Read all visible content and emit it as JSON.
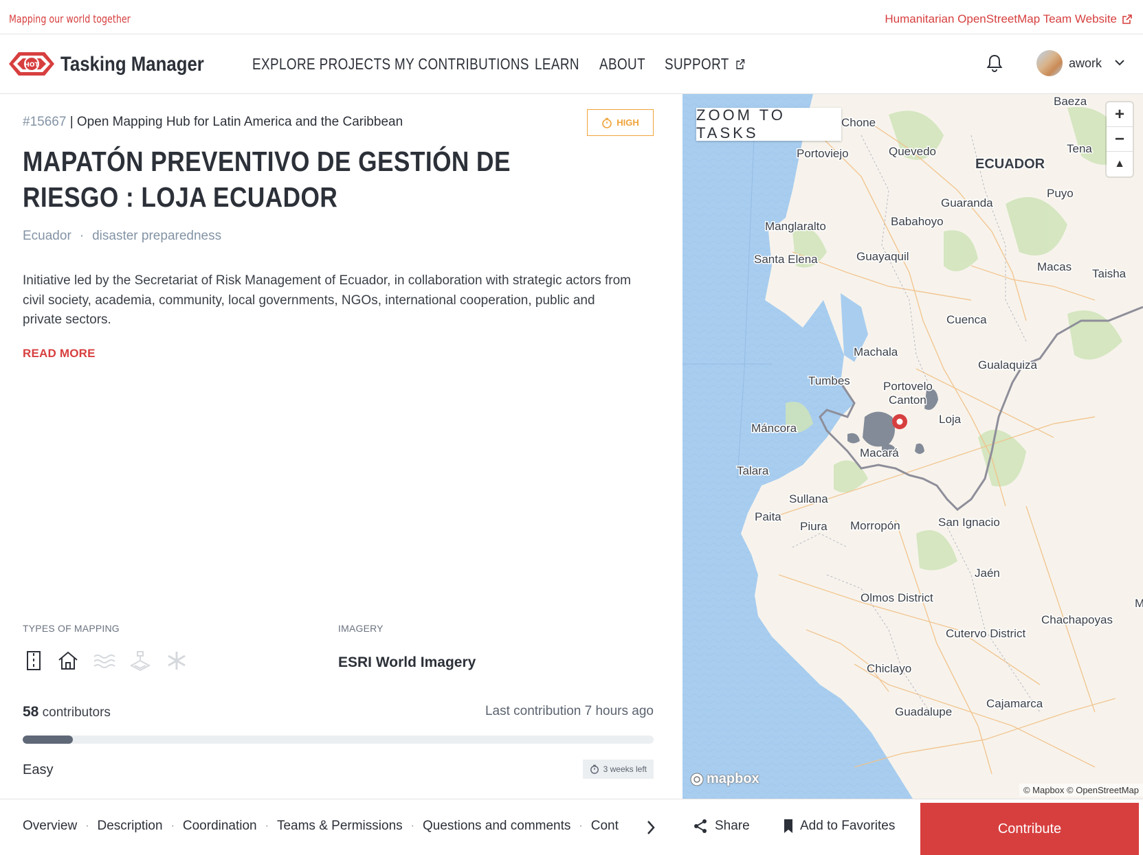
{
  "topbar": {
    "tagline": "Mapping our world together",
    "hot_link": "Humanitarian OpenStreetMap Team Website"
  },
  "nav": {
    "brand": "Tasking Manager",
    "logo_text": "HOT",
    "items": [
      "EXPLORE PROJECTS",
      "MY CONTRIBUTIONS",
      "LEARN",
      "ABOUT",
      "SUPPORT"
    ],
    "username": "awork"
  },
  "project": {
    "id": "#15667",
    "org": "| Open Mapping Hub for Latin America and the Caribbean",
    "priority": "HIGH",
    "title": "MAPATÓN PREVENTIVO DE GESTIÓN DE RIESGO : LOJA ECUADOR",
    "tags": [
      "Ecuador",
      "·",
      "disaster preparedness"
    ],
    "description": "Initiative led by the Secretariat of Risk Management of Ecuador, in collaboration with strategic actors from civil society, academia, community, local governments, NGOs, international cooperation, public and private sectors.",
    "read_more": "READ MORE",
    "types_label": "TYPES OF MAPPING",
    "imagery_label": "IMAGERY",
    "imagery": "ESRI World Imagery",
    "contributors_count": "58",
    "contributors_label": " contributors",
    "last_contribution": "Last contribution 7 hours ago",
    "progress_percent": 8,
    "difficulty": "Easy",
    "time_left": "3 weeks left",
    "mapping_types": [
      "roads-icon",
      "buildings-icon",
      "waterways-icon",
      "landuse-icon",
      "other-icon"
    ]
  },
  "map": {
    "zoom_to_tasks": "ZOOM TO TASKS",
    "attribution": "© Mapbox © OpenStreetMap",
    "mapbox_logo": "mapbox",
    "zoom_in": "+",
    "zoom_out": "−",
    "compass": "▲",
    "places": [
      {
        "name": "Baeza"
      },
      {
        "name": "Chone"
      },
      {
        "name": "Portoviejo"
      },
      {
        "name": "Quevedo"
      },
      {
        "name": "Tena"
      },
      {
        "name": "ECUADOR"
      },
      {
        "name": "Puyo"
      },
      {
        "name": "Guaranda"
      },
      {
        "name": "Manglaralto"
      },
      {
        "name": "Babahoyo"
      },
      {
        "name": "Santa Elena"
      },
      {
        "name": "Guayaquil"
      },
      {
        "name": "Macas"
      },
      {
        "name": "Taisha"
      },
      {
        "name": "Cuenca"
      },
      {
        "name": "Machala"
      },
      {
        "name": "Gualaquiza"
      },
      {
        "name": "Tumbes"
      },
      {
        "name": "Portovelo"
      },
      {
        "name": "Canton"
      },
      {
        "name": "Loja"
      },
      {
        "name": "Máncora"
      },
      {
        "name": "Macará"
      },
      {
        "name": "Talara"
      },
      {
        "name": "Sullana"
      },
      {
        "name": "Paita"
      },
      {
        "name": "Piura"
      },
      {
        "name": "Morropón"
      },
      {
        "name": "San Ignacio"
      },
      {
        "name": "Jaén"
      },
      {
        "name": "Olmos District"
      },
      {
        "name": "Chachapoyas"
      },
      {
        "name": "Cutervo District"
      },
      {
        "name": "Chiclayo"
      },
      {
        "name": "Cajamarca"
      },
      {
        "name": "Guadalupe"
      },
      {
        "name": "M"
      }
    ]
  },
  "bottombar": {
    "tabs": [
      "Overview",
      "Description",
      "Coordination",
      "Teams & Permissions",
      "Questions and comments",
      "Cont"
    ],
    "share": "Share",
    "favorites": "Add to Favorites",
    "contribute": "Contribute"
  },
  "colors": {
    "accent": "#d73f3f",
    "priority_high": "#f0a33a",
    "water": "#a8cdef",
    "land": "#f7f3ec",
    "border": "#8e8e9a"
  }
}
